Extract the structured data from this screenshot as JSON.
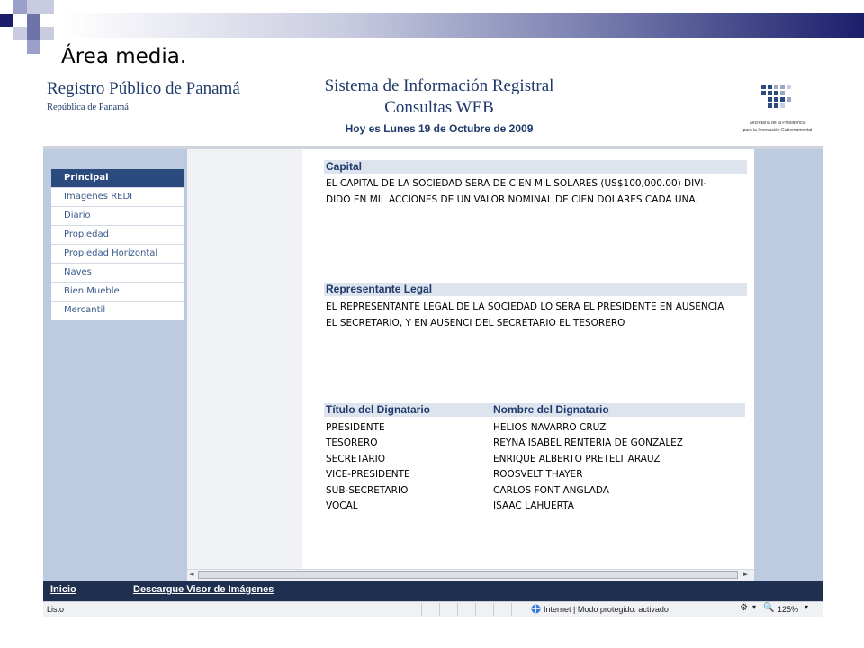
{
  "slide": {
    "title": "Área media."
  },
  "header": {
    "org_title": "Registro Público de Panamá",
    "org_subtitle": "República de Panamá",
    "system_title_line1": "Sistema de Información Registral",
    "system_title_line2": "Consultas WEB",
    "date_line": "Hoy es Lunes 19 de Octubre de 2009",
    "logo_caption_line1": "Secretaría de la Presidencia",
    "logo_caption_line2": "para la Innovación Gubernamental"
  },
  "nav": {
    "items": [
      {
        "label": "Principal"
      },
      {
        "label": "Imagenes REDI"
      },
      {
        "label": "Diario"
      },
      {
        "label": "Propiedad"
      },
      {
        "label": "Propiedad Horizontal"
      },
      {
        "label": "Naves"
      },
      {
        "label": "Bien Mueble"
      },
      {
        "label": "Mercantil"
      }
    ]
  },
  "content": {
    "capital": {
      "heading": "Capital",
      "line1": "EL CAPITAL DE LA SOCIEDAD SERA DE CIEN MIL SOLARES (US$100,000.00) DIVI-",
      "line2": "DIDO EN MIL ACCIONES DE UN VALOR NOMINAL DE CIEN DOLARES CADA UNA."
    },
    "representante": {
      "heading": "Representante Legal",
      "line1": "EL REPRESENTANTE LEGAL DE LA SOCIEDAD LO SERA EL PRESIDENTE EN AUSENCIA",
      "line2": "EL SECRETARIO, Y EN AUSENCI DEL SECRETARIO EL TESORERO"
    },
    "dignatarios": {
      "col_title": "Título del Dignatario",
      "col_name": "Nombre del Dignatario",
      "rows": [
        {
          "title": "PRESIDENTE",
          "name": "HELIOS NAVARRO CRUZ"
        },
        {
          "title": "TESORERO",
          "name": "REYNA ISABEL RENTERIA DE GONZALEZ"
        },
        {
          "title": "SECRETARIO",
          "name": "ENRIQUE ALBERTO PRETELT ARAUZ"
        },
        {
          "title": "VICE-PRESIDENTE",
          "name": "ROOSVELT THAYER"
        },
        {
          "title": "SUB-SECRETARIO",
          "name": "CARLOS FONT ANGLADA"
        },
        {
          "title": "VOCAL",
          "name": "ISAAC LAHUERTA"
        }
      ]
    }
  },
  "footer": {
    "inicio": "Inicio",
    "descargue": "Descargue Visor de Imágenes"
  },
  "status": {
    "left": "Listo",
    "zone": "Internet | Modo protegido: activado",
    "zoom": "125%"
  },
  "colors": {
    "accent_dark": "#1f2f4f",
    "nav_active": "#2b4a7e",
    "heading_text": "#1f3a6b",
    "panel_blue": "#bccbdf"
  }
}
